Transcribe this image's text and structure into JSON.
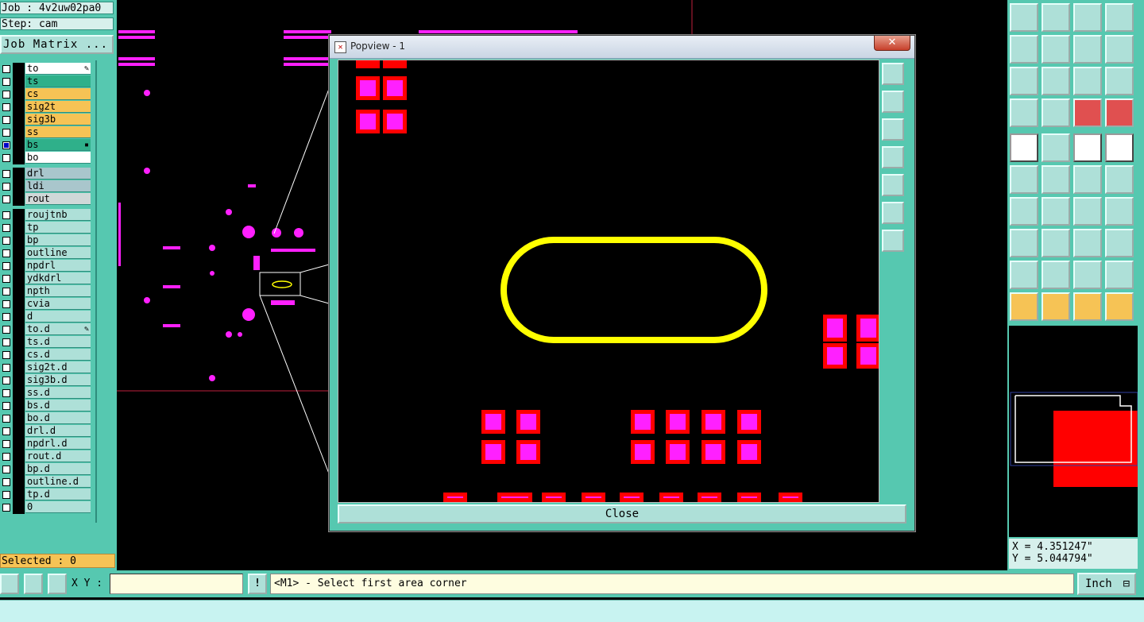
{
  "header": {
    "job": "Job : 4v2uw02pa0",
    "step": "Step: cam",
    "job_matrix_label": "Job Matrix ..."
  },
  "layers": [
    {
      "name": "to",
      "color": "#ffffff",
      "swatch": "",
      "mark": "✎"
    },
    {
      "name": "ts",
      "color": "#2fb08a",
      "swatch": "",
      "mark": ""
    },
    {
      "name": "cs",
      "color": "#f6c355",
      "swatch": "",
      "mark": ""
    },
    {
      "name": "sig2t",
      "color": "#f6c355",
      "swatch": "",
      "mark": ""
    },
    {
      "name": "sig3b",
      "color": "#f6c355",
      "swatch": "",
      "mark": ""
    },
    {
      "name": "ss",
      "color": "#f6c355",
      "swatch": "",
      "mark": ""
    },
    {
      "name": "bs",
      "color": "#2fb08a",
      "swatch": "#ff2020",
      "mark": "▪",
      "checked": true
    },
    {
      "name": "bo",
      "color": "#ffffff",
      "swatch": "",
      "mark": ""
    },
    {
      "name": "drl",
      "color": "#a9c6cc",
      "swatch": "",
      "mark": ""
    },
    {
      "name": "ldi",
      "color": "#a9c6cc",
      "swatch": "",
      "mark": ""
    },
    {
      "name": "rout",
      "color": "#d0d8d8",
      "swatch": "",
      "mark": ""
    },
    {
      "name": "roujtnb",
      "color": "#aee0d8",
      "swatch": "#20d020",
      "mark": ""
    },
    {
      "name": "tp",
      "color": "#aee0d8",
      "swatch": "",
      "mark": ""
    },
    {
      "name": "bp",
      "color": "#aee0d8",
      "swatch": "",
      "mark": ""
    },
    {
      "name": "outline",
      "color": "#aee0d8",
      "swatch": "",
      "mark": ""
    },
    {
      "name": "npdrl",
      "color": "#aee0d8",
      "swatch": "",
      "mark": ""
    },
    {
      "name": "ydkdrl",
      "color": "#aee0d8",
      "swatch": "",
      "mark": ""
    },
    {
      "name": "npth",
      "color": "#aee0d8",
      "swatch": "",
      "mark": ""
    },
    {
      "name": "cvia",
      "color": "#aee0d8",
      "swatch": "",
      "mark": ""
    },
    {
      "name": "d",
      "color": "#aee0d8",
      "swatch": "",
      "mark": ""
    },
    {
      "name": "to.d",
      "color": "#aee0d8",
      "swatch": "",
      "mark": "✎"
    },
    {
      "name": "ts.d",
      "color": "#aee0d8",
      "swatch": "",
      "mark": ""
    },
    {
      "name": "cs.d",
      "color": "#aee0d8",
      "swatch": "",
      "mark": ""
    },
    {
      "name": "sig2t.d",
      "color": "#aee0d8",
      "swatch": "",
      "mark": ""
    },
    {
      "name": "sig3b.d",
      "color": "#aee0d8",
      "swatch": "",
      "mark": ""
    },
    {
      "name": "ss.d",
      "color": "#aee0d8",
      "swatch": "",
      "mark": ""
    },
    {
      "name": "bs.d",
      "color": "#aee0d8",
      "swatch": "#2020ff",
      "mark": ""
    },
    {
      "name": "bo.d",
      "color": "#aee0d8",
      "swatch": "",
      "mark": ""
    },
    {
      "name": "drl.d",
      "color": "#aee0d8",
      "swatch": "",
      "mark": ""
    },
    {
      "name": "npdrl.d",
      "color": "#aee0d8",
      "swatch": "",
      "mark": ""
    },
    {
      "name": "rout.d",
      "color": "#aee0d8",
      "swatch": "",
      "mark": ""
    },
    {
      "name": "bp.d",
      "color": "#aee0d8",
      "swatch": "",
      "mark": ""
    },
    {
      "name": "outline.d",
      "color": "#aee0d8",
      "swatch": "",
      "mark": ""
    },
    {
      "name": "tp.d",
      "color": "#aee0d8",
      "swatch": "",
      "mark": ""
    },
    {
      "name": "0",
      "color": "#aee0d8",
      "swatch": "",
      "mark": ""
    }
  ],
  "selected": "Selected : 0",
  "popview": {
    "title": "Popview - 1",
    "close_label": "Close",
    "close_x": "✕"
  },
  "coords": {
    "x": "X = 4.351247\"",
    "y": "Y = 5.044794\""
  },
  "bottom": {
    "xy_label": "X Y :",
    "xy_value": "",
    "prompt": "<M1> - Select first area corner",
    "units": "Inch",
    "units_icon": "⊟",
    "alert": "!"
  },
  "colors": {
    "panel": "#56c8b0",
    "pad_red": "#ff0000",
    "pad_magenta": "#ff20ff",
    "outline_yellow": "#ffff00"
  }
}
